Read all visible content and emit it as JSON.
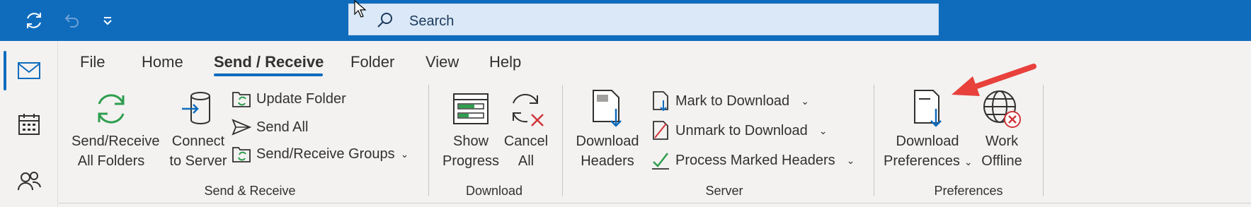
{
  "search": {
    "label": "Search"
  },
  "tabs": [
    {
      "label": "File"
    },
    {
      "label": "Home"
    },
    {
      "label": "Send / Receive"
    },
    {
      "label": "Folder"
    },
    {
      "label": "View"
    },
    {
      "label": "Help"
    }
  ],
  "groups": {
    "send_receive": {
      "label": "Send & Receive",
      "send_receive_all_line1": "Send/Receive",
      "send_receive_all_line2": "All Folders",
      "connect_line1": "Connect",
      "connect_line2": "to Server",
      "update_folder": "Update Folder",
      "send_all": "Send All",
      "send_receive_groups": "Send/Receive Groups"
    },
    "download": {
      "label": "Download",
      "show_progress_line1": "Show",
      "show_progress_line2": "Progress",
      "cancel_all_line1": "Cancel",
      "cancel_all_line2": "All"
    },
    "server": {
      "label": "Server",
      "download_headers_line1": "Download",
      "download_headers_line2": "Headers",
      "mark_to_download": "Mark to Download",
      "unmark_to_download": "Unmark to Download",
      "process_marked_headers": "Process Marked Headers"
    },
    "preferences": {
      "label": "Preferences",
      "download_prefs_line1": "Download",
      "download_prefs_line2": "Preferences",
      "work_offline_line1": "Work",
      "work_offline_line2": "Offline"
    }
  },
  "icons": {
    "titlebar": [
      "sync-icon",
      "undo-icon",
      "customize-quick-access-icon"
    ],
    "rail": [
      "mail-icon",
      "calendar-icon",
      "people-icon"
    ]
  },
  "colors": {
    "titlebar": "#0f6cbd",
    "accent": "#0f6cbd",
    "sync_green": "#2e9e4f",
    "cancel_red": "#d13438",
    "annotation_arrow": "#e8413c"
  }
}
